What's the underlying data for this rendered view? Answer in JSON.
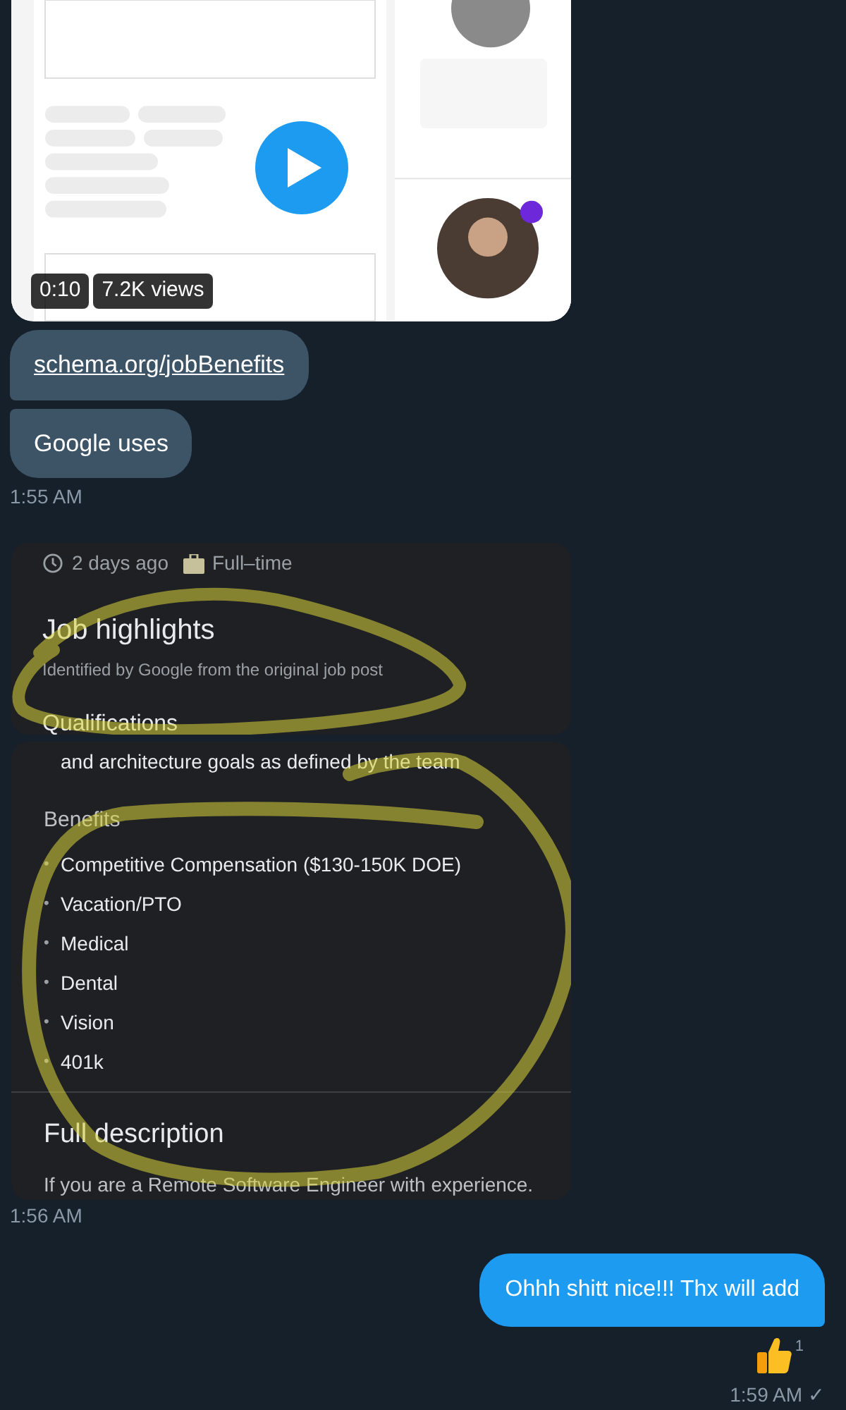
{
  "video": {
    "duration": "0:10",
    "views": "7.2K views"
  },
  "incoming": [
    {
      "kind": "link",
      "text": "schema.org/jobBenefits"
    },
    {
      "kind": "text",
      "text": "Google uses"
    }
  ],
  "time_1": "1:55 AM",
  "screenshot_1": {
    "posted": "2 days ago",
    "job_type": "Full–time",
    "title": "Job highlights",
    "subtitle": "Identified by Google from the original job post",
    "section": "Qualifications"
  },
  "screenshot_2": {
    "cut_line": "and architecture goals as defined by the team",
    "section": "Benefits",
    "bullet": "•",
    "benefits": [
      "Competitive Compensation ($130-150K DOE)",
      "Vacation/PTO",
      "Medical",
      "Dental",
      "Vision",
      "401k"
    ],
    "heading": "Full description",
    "cut_text": "If you are a Remote Software Engineer with experience."
  },
  "time_2": "1:56 AM",
  "sent": {
    "text": "Ohhh shitt nice!!! Thx will add",
    "reaction_count": "1",
    "time": "1:59 AM",
    "status_mark": "✓"
  }
}
